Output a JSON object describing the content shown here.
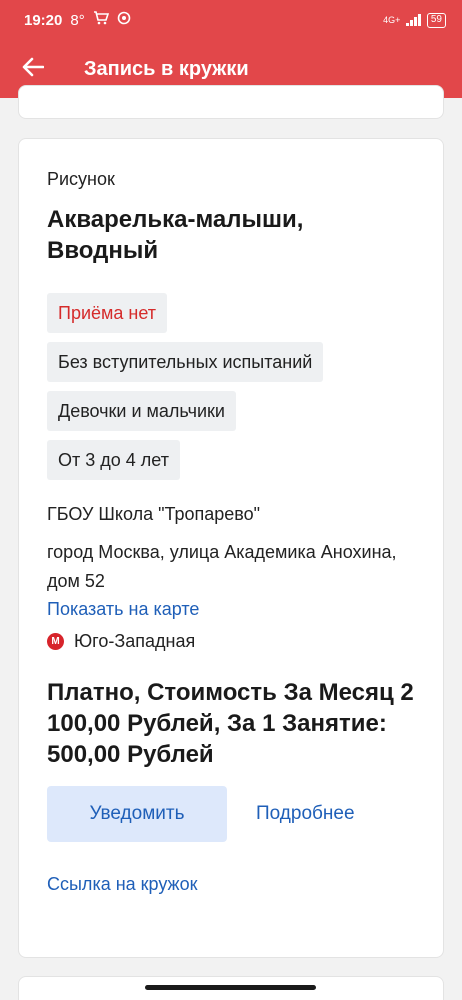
{
  "status": {
    "time": "19:20",
    "temperature": "8°",
    "network": "4G+",
    "battery": "59"
  },
  "appbar": {
    "title": "Запись в кружки"
  },
  "club": {
    "category": "Рисунок",
    "name": "Акварелька-малыши, Вводный",
    "tags": [
      {
        "label": "Приёма нет",
        "color": "#d52b2b"
      },
      {
        "label": "Без вступительных испытаний"
      },
      {
        "label": "Девочки и мальчики"
      },
      {
        "label": "От 3 до 4 лет"
      }
    ],
    "school": "ГБОУ Школа \"Тропарево\"",
    "address": "город Москва, улица Академика Анохина, дом 52",
    "map_link": "Показать на карте",
    "metro_icon": "М",
    "metro": "Юго-Западная",
    "price": "Платно, Стоимость За Месяц 2 100,00 Рублей, За 1 Занятие: 500,00 Рублей",
    "notify_button": "Уведомить",
    "more_button": "Подробнее",
    "club_link": "Ссылка на кружок"
  },
  "colors": {
    "brand": "#e2474a",
    "link": "#1f5fb8",
    "button_bg": "#dde8fb",
    "metro": "#d7242b"
  }
}
